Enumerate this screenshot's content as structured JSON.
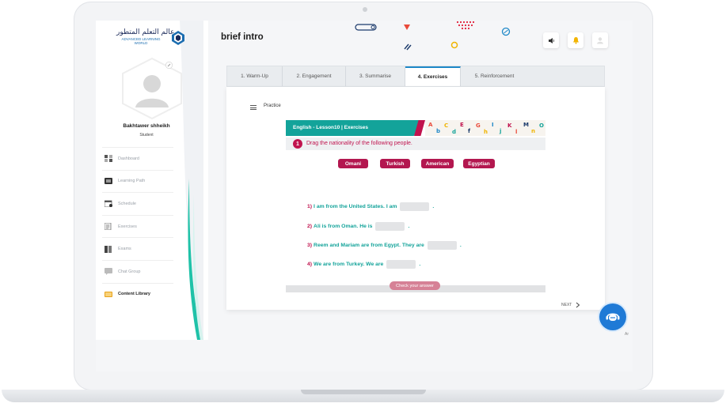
{
  "sidebar": {
    "logo_arabic": "عالم التعلم المتطور",
    "logo_english": "ADVANCED LEARNING WORLD",
    "logo_mark": "ALW",
    "user_name": "Bakhtawer shheikh",
    "user_role": "Student",
    "items": [
      {
        "label": "Dashboard",
        "icon": "dashboard-icon"
      },
      {
        "label": "Learning Path",
        "icon": "learning-path-icon"
      },
      {
        "label": "Schedule",
        "icon": "calendar-icon"
      },
      {
        "label": "Exercises",
        "icon": "exercises-icon"
      },
      {
        "label": "Exams",
        "icon": "exams-icon"
      },
      {
        "label": "Chat Group",
        "icon": "chat-group-icon"
      },
      {
        "label": "Content Library",
        "icon": "book-icon",
        "active": true
      }
    ]
  },
  "header": {
    "title": "brief intro",
    "buttons": [
      "megaphone-icon",
      "bell-icon",
      "user-icon"
    ]
  },
  "tabs": [
    {
      "label": "1. Warm-Up"
    },
    {
      "label": "2. Engagement"
    },
    {
      "label": "3. Summarise"
    },
    {
      "label": "4. Exercises",
      "active": true
    },
    {
      "label": "5. Reinforcement"
    }
  ],
  "content": {
    "practice_label": "Practice",
    "exercise_title": "English - Lesson10  |  Exercises",
    "question_number": "1",
    "question_text": "Drag the nationality of the following people.",
    "choices": [
      "Omani",
      "Turkish",
      "American",
      "Egyptian"
    ],
    "sentences": [
      {
        "num": "1)",
        "before": "I am from the United States.  I am",
        "after": "."
      },
      {
        "num": "2)",
        "before": "Ali is from Oman. He is",
        "after": "."
      },
      {
        "num": "3)",
        "before": "Reem and Mariam are from Egypt. They are",
        "after": "."
      },
      {
        "num": "4)",
        "before": "We are from Turkey. We are",
        "after": "."
      }
    ],
    "check_button": "Check your answer",
    "next_label": "NEXT"
  },
  "footer": {
    "corner_text": "Ar"
  },
  "colors": {
    "teal": "#13a39a",
    "crimson": "#c0134e",
    "tab_active_border": "#1e88c8",
    "chat_button": "#1f7ad6"
  }
}
